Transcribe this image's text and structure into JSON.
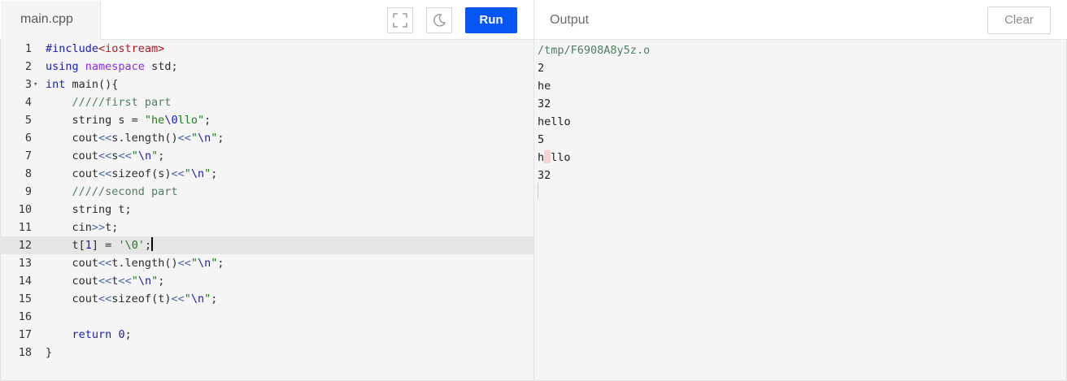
{
  "header": {
    "file_tab": "main.cpp",
    "run_label": "Run",
    "output_label": "Output",
    "clear_label": "Clear"
  },
  "icons": {
    "fullscreen": "fullscreen-icon",
    "theme": "moon-icon",
    "fold": "fold-arrow-icon"
  },
  "colors": {
    "run_button": "#0556f3",
    "editor_bg": "#f5f5f5",
    "active_line": "#e5e5e5"
  },
  "editor": {
    "active_line": 12,
    "lines": [
      {
        "n": "1",
        "tokens": [
          {
            "t": "#include",
            "c": "kw"
          },
          {
            "t": "<iostream>",
            "c": "inc"
          }
        ]
      },
      {
        "n": "2",
        "tokens": [
          {
            "t": "using",
            "c": "kw"
          },
          {
            "t": " ",
            "c": "ident"
          },
          {
            "t": "namespace",
            "c": "sys"
          },
          {
            "t": " std;",
            "c": "ident"
          }
        ]
      },
      {
        "n": "3",
        "fold": true,
        "tokens": [
          {
            "t": "int",
            "c": "kw"
          },
          {
            "t": " main(){",
            "c": "ident"
          }
        ]
      },
      {
        "n": "4",
        "tokens": [
          {
            "t": "    /////first part",
            "c": "cmt"
          }
        ]
      },
      {
        "n": "5",
        "tokens": [
          {
            "t": "    string s = ",
            "c": "ident"
          },
          {
            "t": "\"he",
            "c": "str"
          },
          {
            "t": "\\0",
            "c": "esc"
          },
          {
            "t": "llo\"",
            "c": "str"
          },
          {
            "t": ";",
            "c": "ident"
          }
        ]
      },
      {
        "n": "6",
        "tokens": [
          {
            "t": "    cout",
            "c": "ident"
          },
          {
            "t": "<<",
            "c": "op"
          },
          {
            "t": "s.length()",
            "c": "ident"
          },
          {
            "t": "<<",
            "c": "op"
          },
          {
            "t": "\"",
            "c": "str"
          },
          {
            "t": "\\n",
            "c": "esc"
          },
          {
            "t": "\"",
            "c": "str"
          },
          {
            "t": ";",
            "c": "ident"
          }
        ]
      },
      {
        "n": "7",
        "tokens": [
          {
            "t": "    cout",
            "c": "ident"
          },
          {
            "t": "<<",
            "c": "op"
          },
          {
            "t": "s",
            "c": "ident"
          },
          {
            "t": "<<",
            "c": "op"
          },
          {
            "t": "\"",
            "c": "str"
          },
          {
            "t": "\\n",
            "c": "esc"
          },
          {
            "t": "\"",
            "c": "str"
          },
          {
            "t": ";",
            "c": "ident"
          }
        ]
      },
      {
        "n": "8",
        "tokens": [
          {
            "t": "    cout",
            "c": "ident"
          },
          {
            "t": "<<",
            "c": "op"
          },
          {
            "t": "sizeof(s)",
            "c": "ident"
          },
          {
            "t": "<<",
            "c": "op"
          },
          {
            "t": "\"",
            "c": "str"
          },
          {
            "t": "\\n",
            "c": "esc"
          },
          {
            "t": "\"",
            "c": "str"
          },
          {
            "t": ";",
            "c": "ident"
          }
        ]
      },
      {
        "n": "9",
        "tokens": [
          {
            "t": "    /////second part",
            "c": "cmt"
          }
        ]
      },
      {
        "n": "10",
        "tokens": [
          {
            "t": "    string t;",
            "c": "ident"
          }
        ]
      },
      {
        "n": "11",
        "tokens": [
          {
            "t": "    cin",
            "c": "ident"
          },
          {
            "t": ">>",
            "c": "op"
          },
          {
            "t": "t;",
            "c": "ident"
          }
        ]
      },
      {
        "n": "12",
        "cursor": true,
        "tokens": [
          {
            "t": "    t[",
            "c": "ident"
          },
          {
            "t": "1",
            "c": "num-lit"
          },
          {
            "t": "] = ",
            "c": "ident"
          },
          {
            "t": "'\\0'",
            "c": "str"
          },
          {
            "t": ";",
            "c": "ident"
          }
        ]
      },
      {
        "n": "13",
        "tokens": [
          {
            "t": "    cout",
            "c": "ident"
          },
          {
            "t": "<<",
            "c": "op"
          },
          {
            "t": "t.length()",
            "c": "ident"
          },
          {
            "t": "<<",
            "c": "op"
          },
          {
            "t": "\"",
            "c": "str"
          },
          {
            "t": "\\n",
            "c": "esc"
          },
          {
            "t": "\"",
            "c": "str"
          },
          {
            "t": ";",
            "c": "ident"
          }
        ]
      },
      {
        "n": "14",
        "tokens": [
          {
            "t": "    cout",
            "c": "ident"
          },
          {
            "t": "<<",
            "c": "op"
          },
          {
            "t": "t",
            "c": "ident"
          },
          {
            "t": "<<",
            "c": "op"
          },
          {
            "t": "\"",
            "c": "str"
          },
          {
            "t": "\\n",
            "c": "esc"
          },
          {
            "t": "\"",
            "c": "str"
          },
          {
            "t": ";",
            "c": "ident"
          }
        ]
      },
      {
        "n": "15",
        "tokens": [
          {
            "t": "    cout",
            "c": "ident"
          },
          {
            "t": "<<",
            "c": "op"
          },
          {
            "t": "sizeof(t)",
            "c": "ident"
          },
          {
            "t": "<<",
            "c": "op"
          },
          {
            "t": "\"",
            "c": "str"
          },
          {
            "t": "\\n",
            "c": "esc"
          },
          {
            "t": "\"",
            "c": "str"
          },
          {
            "t": ";",
            "c": "ident"
          }
        ]
      },
      {
        "n": "16",
        "tokens": []
      },
      {
        "n": "17",
        "tokens": [
          {
            "t": "    ",
            "c": "ident"
          },
          {
            "t": "return",
            "c": "kw"
          },
          {
            "t": " ",
            "c": "ident"
          },
          {
            "t": "0",
            "c": "num-lit"
          },
          {
            "t": ";",
            "c": "ident"
          }
        ]
      },
      {
        "n": "18",
        "tokens": [
          {
            "t": "}",
            "c": "ident"
          }
        ]
      }
    ]
  },
  "output": {
    "lines": [
      {
        "text": "/tmp/F6908A8y5z.o",
        "path": true
      },
      {
        "text": "2"
      },
      {
        "text": "he"
      },
      {
        "text": "32"
      },
      {
        "text": "hello"
      },
      {
        "text": "5"
      },
      {
        "parts": [
          "h",
          "llo"
        ],
        "nul": true
      },
      {
        "text": "32"
      }
    ]
  }
}
